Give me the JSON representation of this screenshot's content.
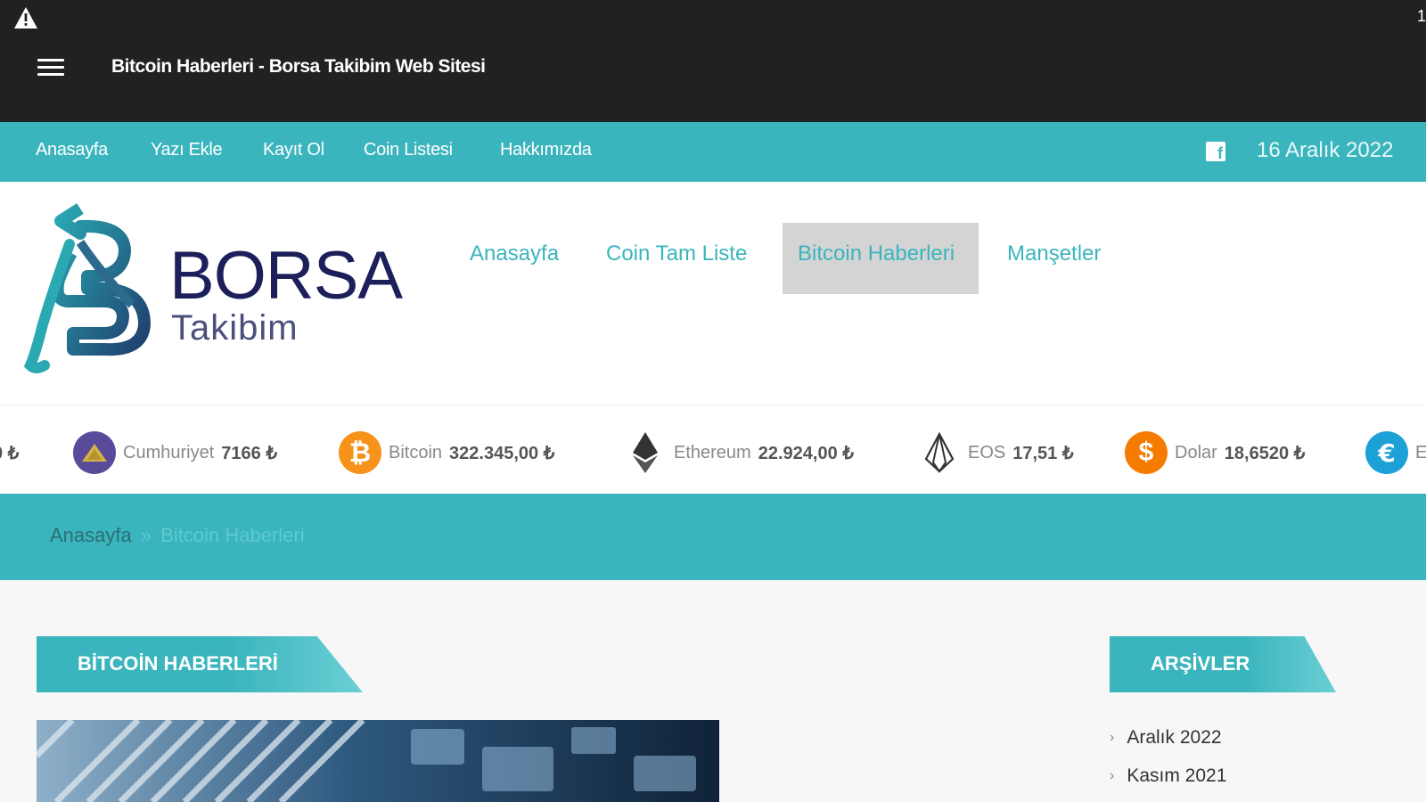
{
  "appbar": {
    "title": "Bitcoin Haberleri - Borsa Takibim Web Sitesi",
    "status_right": "1"
  },
  "topnav": {
    "items": [
      "Anasayfa",
      "Yazı Ekle",
      "Kayıt Ol",
      "Coin Listesi",
      "Hakkımızda"
    ],
    "date": "16 Aralık 2022"
  },
  "logo": {
    "borsa": "BORSA",
    "takibim": "Takibim"
  },
  "mainnav": {
    "items": [
      "Anasayfa",
      "Coin Tam Liste",
      "Bitcoin Haberleri",
      "Manşetler"
    ],
    "active_index": 2
  },
  "ticker": {
    "items": [
      {
        "name": "",
        "value": "0 ₺",
        "icon": "coin-icon"
      },
      {
        "name": "Cumhuriyet",
        "value": "7166 ₺",
        "icon": "gold-icon",
        "color": "#5a4b9a"
      },
      {
        "name": "Bitcoin",
        "value": "322.345,00 ₺",
        "icon": "bitcoin-icon",
        "color": "#f7931a"
      },
      {
        "name": "Ethereum",
        "value": "22.924,00 ₺",
        "icon": "ethereum-icon",
        "color": "#333333"
      },
      {
        "name": "EOS",
        "value": "17,51 ₺",
        "icon": "eos-icon",
        "color": "#333333"
      },
      {
        "name": "Dolar",
        "value": "18,6520 ₺",
        "icon": "dollar-icon",
        "color": "#f57c00"
      },
      {
        "name": "E",
        "value": "",
        "icon": "euro-icon",
        "color": "#1ba1d6"
      }
    ]
  },
  "breadcrumb": {
    "home": "Anasayfa",
    "separator": "»",
    "current": "Bitcoin Haberleri"
  },
  "content": {
    "section_title": "BİTCOİN HABERLERİ",
    "sidebar_title": "ARŞİVLER",
    "archives": [
      "Aralık 2022",
      "Kasım 2021"
    ]
  },
  "colors": {
    "accent": "#3bb5bd",
    "appbar": "#212121",
    "logo_navy": "#1c1f5a"
  }
}
